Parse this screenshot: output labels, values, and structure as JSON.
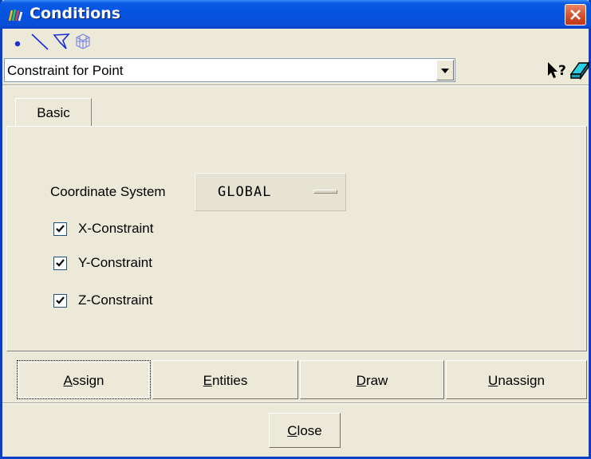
{
  "window": {
    "title": "Conditions"
  },
  "entity_types": [
    {
      "name": "point-icon"
    },
    {
      "name": "line-icon"
    },
    {
      "name": "surface-icon"
    },
    {
      "name": "volume-icon"
    }
  ],
  "condition": {
    "selected": "Constraint for Point"
  },
  "toolbar_icons": {
    "help": "context-help-icon",
    "eraser": "eraser-icon"
  },
  "tabs": [
    {
      "label": "Basic"
    }
  ],
  "basic": {
    "coordinate_system_label": "Coordinate System",
    "coordinate_system_value": "GLOBAL",
    "constraints": [
      {
        "label": "X-Constraint",
        "checked": true
      },
      {
        "label": "Y-Constraint",
        "checked": true
      },
      {
        "label": "Z-Constraint",
        "checked": true
      }
    ]
  },
  "actions": {
    "assign_prefix": "A",
    "assign_rest": "ssign",
    "entities_prefix": "E",
    "entities_rest": "ntities",
    "draw_prefix": "D",
    "draw_rest": "raw",
    "unassign_prefix": "U",
    "unassign_rest": "nassign"
  },
  "footer": {
    "close_prefix": "C",
    "close_rest": "lose"
  }
}
